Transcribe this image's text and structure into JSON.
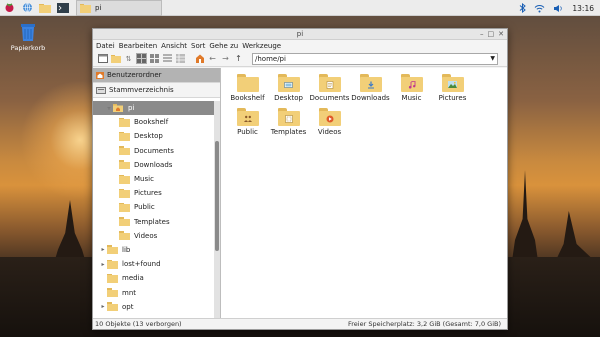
{
  "desktop": {
    "trash_label": "Papierkorb"
  },
  "panel": {
    "task_label": "pi",
    "clock": "13:16"
  },
  "window": {
    "title": "pi",
    "menu": [
      "Datei",
      "Bearbeiten",
      "Ansicht",
      "Sort",
      "Gehe zu",
      "Werkzeuge"
    ],
    "address": "/home/pi",
    "places": [
      {
        "label": "Benutzerordner",
        "icon": "home-icon",
        "selected": true
      },
      {
        "label": "Stammverzeichnis",
        "icon": "drive-icon",
        "selected": false
      }
    ],
    "tree": [
      {
        "label": "pi",
        "indent": 2,
        "expander": "collapse",
        "selected": true,
        "icon": "home"
      },
      {
        "label": "Bookshelf",
        "indent": 3,
        "icon": "folder"
      },
      {
        "label": "Desktop",
        "indent": 3,
        "icon": "desktop"
      },
      {
        "label": "Documents",
        "indent": 3,
        "icon": "documents"
      },
      {
        "label": "Downloads",
        "indent": 3,
        "icon": "downloads"
      },
      {
        "label": "Music",
        "indent": 3,
        "icon": "music"
      },
      {
        "label": "Pictures",
        "indent": 3,
        "icon": "pictures"
      },
      {
        "label": "Public",
        "indent": 3,
        "icon": "public"
      },
      {
        "label": "Templates",
        "indent": 3,
        "icon": "templates"
      },
      {
        "label": "Videos",
        "indent": 3,
        "icon": "videos"
      },
      {
        "label": "lib",
        "indent": 1,
        "expander": "expand",
        "icon": "folder"
      },
      {
        "label": "lost+found",
        "indent": 1,
        "expander": "expand",
        "icon": "folder"
      },
      {
        "label": "media",
        "indent": 1,
        "icon": "folder"
      },
      {
        "label": "mnt",
        "indent": 1,
        "icon": "folder"
      },
      {
        "label": "opt",
        "indent": 1,
        "expander": "expand",
        "icon": "folder"
      }
    ],
    "files": [
      {
        "label": "Bookshelf",
        "icon": "folder"
      },
      {
        "label": "Desktop",
        "icon": "desktop"
      },
      {
        "label": "Documents",
        "icon": "documents"
      },
      {
        "label": "Downloads",
        "icon": "downloads"
      },
      {
        "label": "Music",
        "icon": "music"
      },
      {
        "label": "Pictures",
        "icon": "pictures"
      },
      {
        "label": "Public",
        "icon": "public"
      },
      {
        "label": "Templates",
        "icon": "templates"
      },
      {
        "label": "Videos",
        "icon": "videos"
      }
    ],
    "status_left": "10 Objekte (13 verborgen)",
    "status_right": "Freier Speicherplatz: 3,2 GiB (Gesamt: 7,0 GiB)"
  }
}
